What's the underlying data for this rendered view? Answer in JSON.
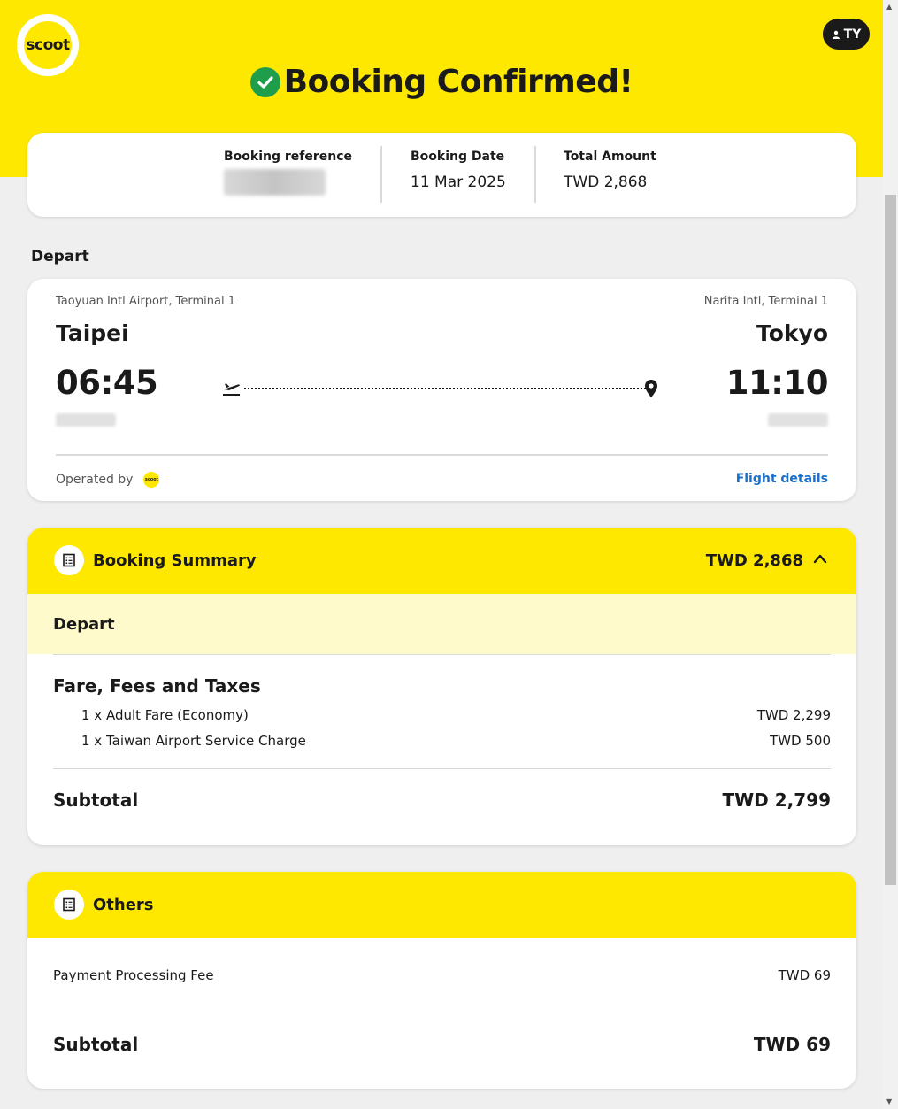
{
  "header": {
    "logo_text": "scoot",
    "user_initials": "TY",
    "title": "Booking Confirmed!"
  },
  "booking": {
    "ref_label": "Booking reference",
    "date_label": "Booking Date",
    "date_value": "11 Mar 2025",
    "total_label": "Total Amount",
    "total_value": "TWD 2,868"
  },
  "depart_label": "Depart",
  "flight": {
    "origin_airport": "Taoyuan Intl Airport, Terminal 1",
    "origin_city": "Taipei",
    "depart_time": "06:45",
    "dest_airport": "Narita Intl, Terminal 1",
    "dest_city": "Tokyo",
    "arrive_time": "11:10",
    "operated_by": "Operated by",
    "operator_logo_text": "scoot",
    "details_link": "Flight details"
  },
  "summary": {
    "title": "Booking Summary",
    "total": "TWD 2,868",
    "subhead": "Depart",
    "fare_title": "Fare, Fees and Taxes",
    "items": [
      {
        "label": "1 x Adult Fare (Economy)",
        "amount": "TWD 2,299"
      },
      {
        "label": "1 x Taiwan Airport Service Charge",
        "amount": "TWD 500"
      }
    ],
    "subtotal_label": "Subtotal",
    "subtotal_value": "TWD 2,799"
  },
  "others": {
    "title": "Others",
    "items": [
      {
        "label": "Payment Processing Fee",
        "amount": "TWD 69"
      }
    ],
    "subtotal_label": "Subtotal",
    "subtotal_value": "TWD 69"
  },
  "colors": {
    "brand_yellow": "#ffe800",
    "light_yellow": "#fffacc",
    "link_blue": "#1a6fc9",
    "success_green": "#1e9e4a"
  }
}
